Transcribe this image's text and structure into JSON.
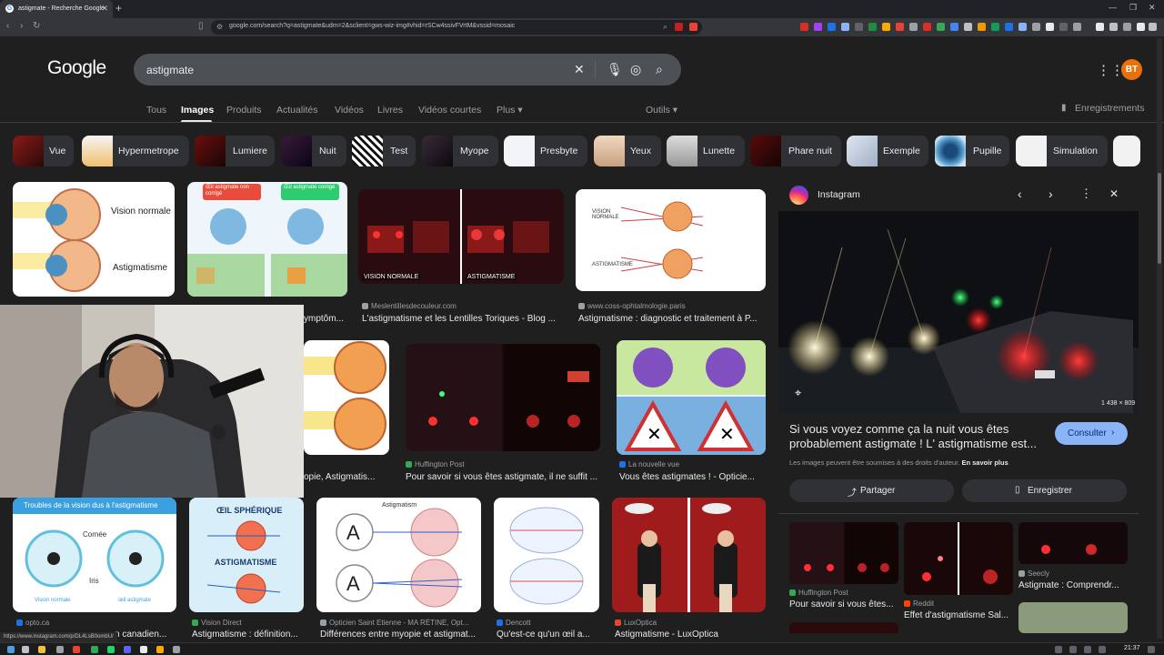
{
  "browser": {
    "tab_title": "astigmate - Recherche Google",
    "url": "google.com/search?q=astigmate&udm=2&sclient=gws-wiz-img#vhid=rSCw4ssivFVrtM&vssid=mosaic"
  },
  "google": {
    "logo": "Google",
    "query": "astigmate",
    "avatar": "BT"
  },
  "nav": {
    "tabs": [
      "Tous",
      "Images",
      "Produits",
      "Actualités",
      "Vidéos",
      "Livres",
      "Vidéos courtes",
      "Plus ▾"
    ],
    "tools": "Outils ▾",
    "saved": "Enregistrements"
  },
  "chips": [
    "Vue",
    "Hypermetrope",
    "Lumiere",
    "Nuit",
    "Test",
    "Myope",
    "Presbyte",
    "Yeux",
    "Lunette",
    "Phare nuit",
    "Exemple",
    "Pupille",
    "Simulation"
  ],
  "results": {
    "r1": {
      "labels": [
        "Vision normale",
        "Astigmatisme"
      ]
    },
    "r2": {
      "labels": [
        "Œil astigmate non corrigé",
        "Œil astigmate corrigé"
      ],
      "cap": "ymptôm..."
    },
    "r3": {
      "labels": [
        "VISION NORMALE",
        "ASTIGMATISME"
      ],
      "source": "Meslentillesdecouleur.com",
      "cap": "L'astigmatisme et les Lentilles Toriques - Blog ..."
    },
    "r4": {
      "labels": [
        "VISION NORMALE",
        "ASTIGMATISME"
      ],
      "source": "www.coss-ophtalmologie.paris",
      "cap": "Astigmatisme : diagnostic et traitement à P..."
    },
    "r5": {
      "cap": "opie, Astigmatis..."
    },
    "r6": {
      "source": "Huffington Post",
      "cap": "Pour savoir si vous êtes astigmate, il ne suffit ..."
    },
    "r7": {
      "source": "La nouvelle vue",
      "cap": "Vous êtes astigmates ! - Opticie..."
    },
    "r8": {
      "title": "Troubles de la vision dus à l'astigmatisme",
      "labels": [
        "Cornée",
        "Iris",
        "Vision normale",
        "œil astigmate"
      ],
      "source": "opto.ca",
      "cap": "n canadien..."
    },
    "r9": {
      "title": "ŒIL SPHÉRIQUE",
      "title2": "ASTIGMATISME",
      "source": "Vision Direct",
      "cap": "Astigmatisme : définition..."
    },
    "r10": {
      "title": "Astigmatism",
      "letter": "A",
      "source": "Opticien Saint Etienne - MA RÉTINE, Opt...",
      "cap": "Différences entre myopie et astigmat..."
    },
    "r11": {
      "source": "Dencott",
      "cap": "Qu'est-ce qu'un œil a..."
    },
    "r12": {
      "source": "LuxOptica",
      "cap": "Astigmatisme - LuxOptica"
    }
  },
  "panel": {
    "source": "Instagram",
    "dimensions": "1 438 × 809",
    "title": "Si vous voyez comme ça la nuit vous êtes probablement astigmate ! L' astigmatisme est...",
    "visit": "Consulter",
    "rights": "Les images peuvent être soumises à des droits d'auteur.",
    "rights_link": "En savoir plus",
    "share": "Partager",
    "save": "Enregistrer",
    "related": [
      {
        "source": "Huffington Post",
        "cap": "Pour savoir si vous êtes..."
      },
      {
        "source": "Reddit",
        "cap": "Effet d'astigmatisme Sal..."
      },
      {
        "source": "Seecly",
        "cap": "Astigmate : Comprendr..."
      }
    ]
  },
  "status_url": "https://www.instagram.com/p/DL4LsB0ombU/",
  "clock": "21:37",
  "colors": {
    "accent": "#8ab4f8",
    "bg": "#1f1f1f",
    "chip": "#303134"
  }
}
